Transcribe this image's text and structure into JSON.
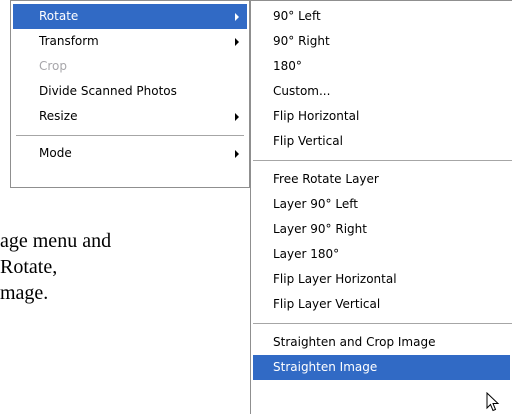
{
  "main_menu": {
    "items": [
      {
        "label": "Rotate"
      },
      {
        "label": "Transform"
      },
      {
        "label": "Crop"
      },
      {
        "label": "Divide Scanned Photos"
      },
      {
        "label": "Resize"
      },
      {
        "label": "Mode"
      }
    ]
  },
  "rotate_submenu": {
    "items": [
      {
        "label": "90° Left"
      },
      {
        "label": "90° Right"
      },
      {
        "label": "180°"
      },
      {
        "label": "Custom..."
      },
      {
        "label": "Flip Horizontal"
      },
      {
        "label": "Flip Vertical"
      },
      {
        "label": "Free Rotate Layer"
      },
      {
        "label": "Layer 90° Left"
      },
      {
        "label": "Layer 90° Right"
      },
      {
        "label": "Layer 180°"
      },
      {
        "label": "Flip Layer Horizontal"
      },
      {
        "label": "Flip Layer Vertical"
      },
      {
        "label": "Straighten and Crop Image"
      },
      {
        "label": "Straighten Image"
      }
    ]
  },
  "caption": {
    "line1": "age menu and",
    "line2": "Rotate,",
    "line3": "mage."
  },
  "colors": {
    "highlight": "#316ac5",
    "disabled": "#a7a6aa",
    "separator": "#a6a6a6"
  }
}
